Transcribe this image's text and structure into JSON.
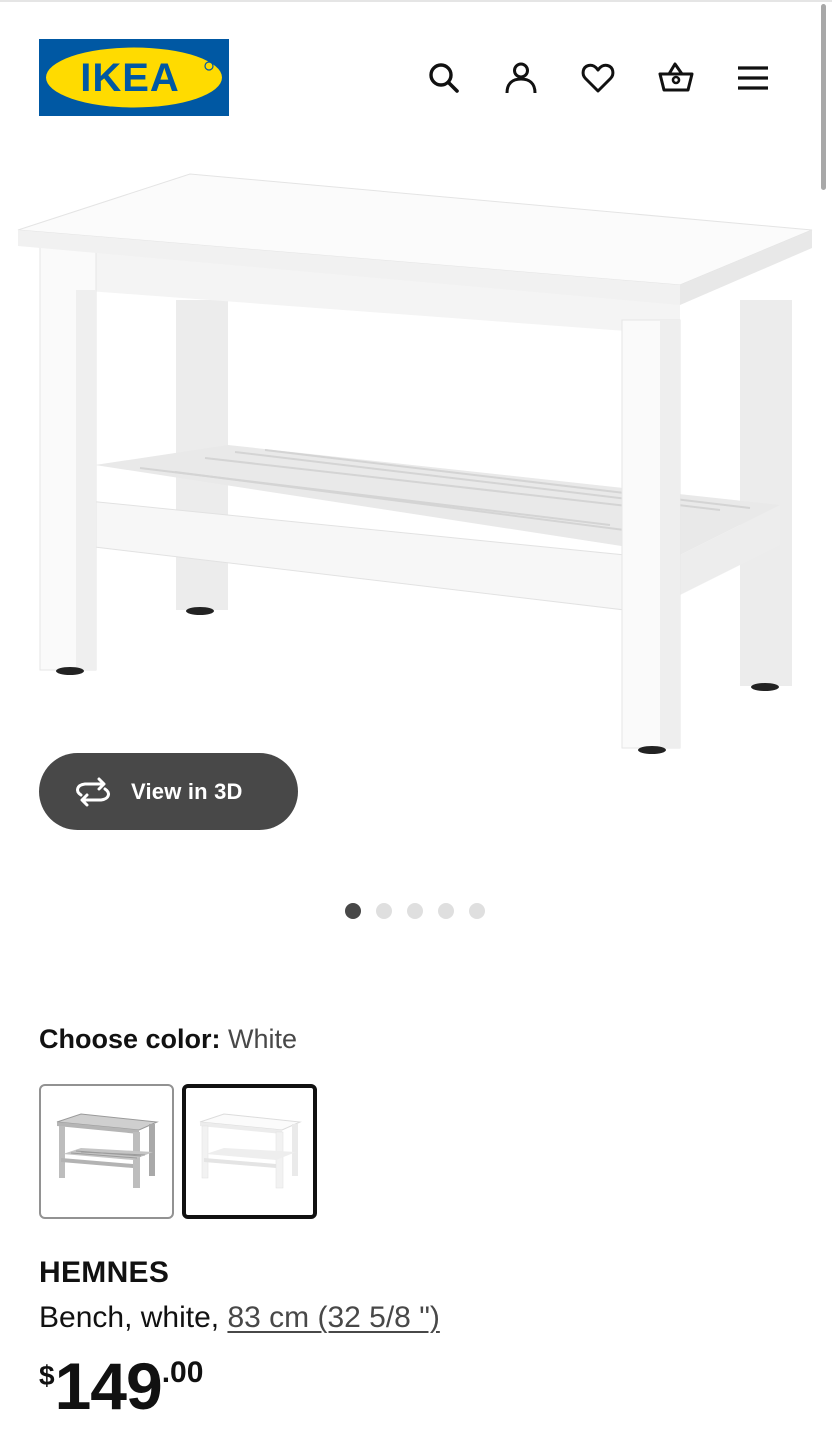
{
  "header": {
    "logo_text": "IKEA",
    "icons": [
      "search-icon",
      "account-icon",
      "heart-icon",
      "basket-icon",
      "menu-icon"
    ]
  },
  "gallery": {
    "view3d_label": "View in 3D",
    "slide_count": 5,
    "active_slide": 1
  },
  "color_choice": {
    "label": "Choose color:",
    "selected": "White",
    "swatches": [
      "gray",
      "white"
    ],
    "selected_index": 1
  },
  "product": {
    "name": "HEMNES",
    "description": "Bench, white, ",
    "dimension_link": "83 cm (32 5/8 \")",
    "price": {
      "currency": "$",
      "integer": "149",
      "decimal": ".00"
    }
  },
  "colors": {
    "brand_blue": "#0058a3",
    "brand_yellow": "#ffdb00",
    "button_dark": "#484848"
  }
}
